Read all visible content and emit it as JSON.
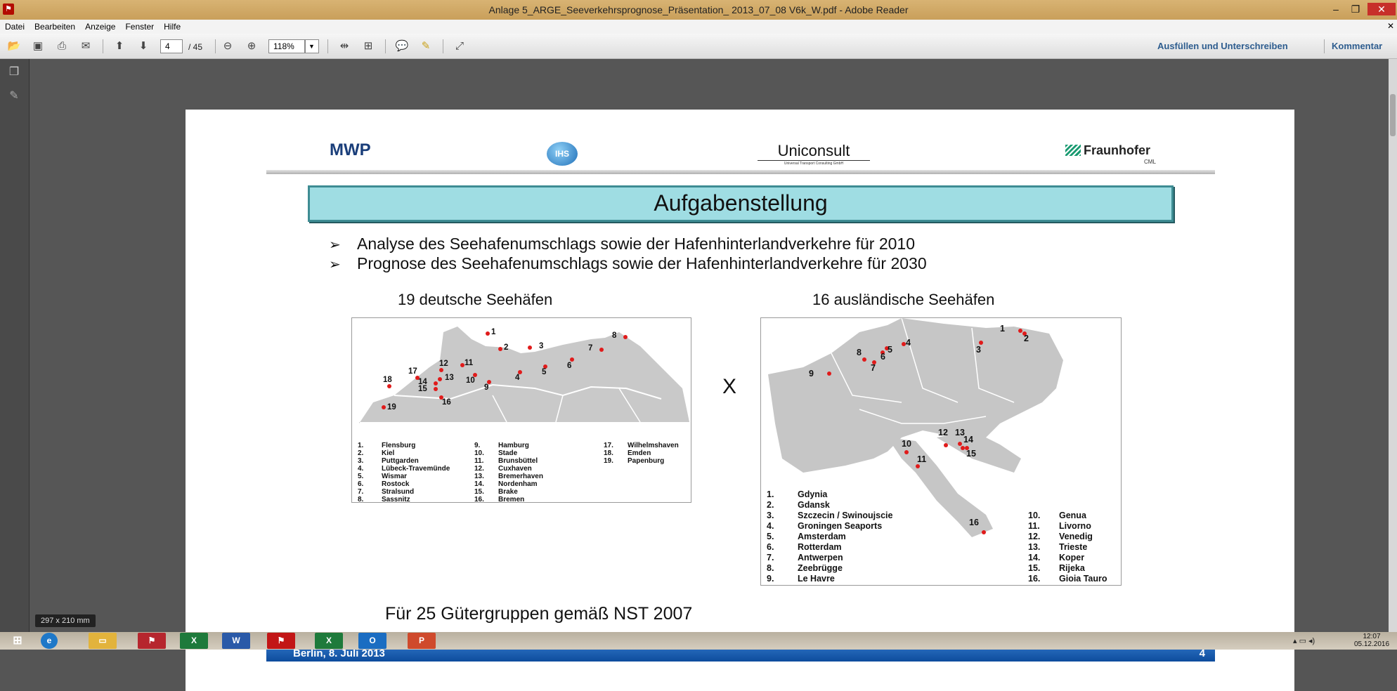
{
  "window": {
    "title": "Anlage 5_ARGE_Seeverkehrsprognose_Präsentation_ 2013_07_08 V6k_W.pdf - Adobe Reader"
  },
  "menu": {
    "items": [
      "Datei",
      "Bearbeiten",
      "Anzeige",
      "Fenster",
      "Hilfe"
    ]
  },
  "toolbar": {
    "page_current": "4",
    "page_total": "/ 45",
    "zoom": "118%",
    "fill_sign": "Ausfüllen und Unterschreiben",
    "comment": "Kommentar"
  },
  "page": {
    "logos": {
      "mwp": "MWP",
      "ihs": "IHS",
      "uniconsult": "Uniconsult",
      "uniconsult_sub": "Universal Transport Consulting GmbH",
      "fraunhofer": "Fraunhofer",
      "fraunhofer_sub": "CML"
    },
    "heading": "Aufgabenstellung",
    "bullets": [
      "Analyse des Seehafenumschlags sowie der Hafenhinterlandverkehre für 2010",
      "Prognose des Seehafenumschlags sowie der Hafenhinterlandverkehre für 2030"
    ],
    "map_de": {
      "title": "19 deutsche Seehäfen",
      "ports": [
        "Flensburg",
        "Kiel",
        "Puttgarden",
        "Lübeck-Travemünde",
        "Wismar",
        "Rostock",
        "Stralsund",
        "Sassnitz",
        "Hamburg",
        "Stade",
        "Brunsbüttel",
        "Cuxhaven",
        "Bremerhaven",
        "Nordenham",
        "Brake",
        "Bremen",
        "Wilhelmshaven",
        "Emden",
        "Papenburg"
      ]
    },
    "times_sign": "X",
    "map_eu": {
      "title": "16 ausländische Seehäfen",
      "ports": [
        "Gdynia",
        "Gdansk",
        "Szczecin / Swinoujscie",
        "Groningen Seaports",
        "Amsterdam",
        "Rotterdam",
        "Antwerpen",
        "Zeebrügge",
        "Le Havre",
        "Genua",
        "Livorno",
        "Venedig",
        "Trieste",
        "Koper",
        "Rijeka",
        "Gioia Tauro"
      ]
    },
    "note": "Für 25 Gütergruppen gemäß NST 2007",
    "footer_left": "Berlin,  8. Juli 2013",
    "footer_right": "4"
  },
  "page_size_badge": "297 x 210 mm",
  "tray": {
    "time": "12:07",
    "date": "05.12.2016"
  }
}
